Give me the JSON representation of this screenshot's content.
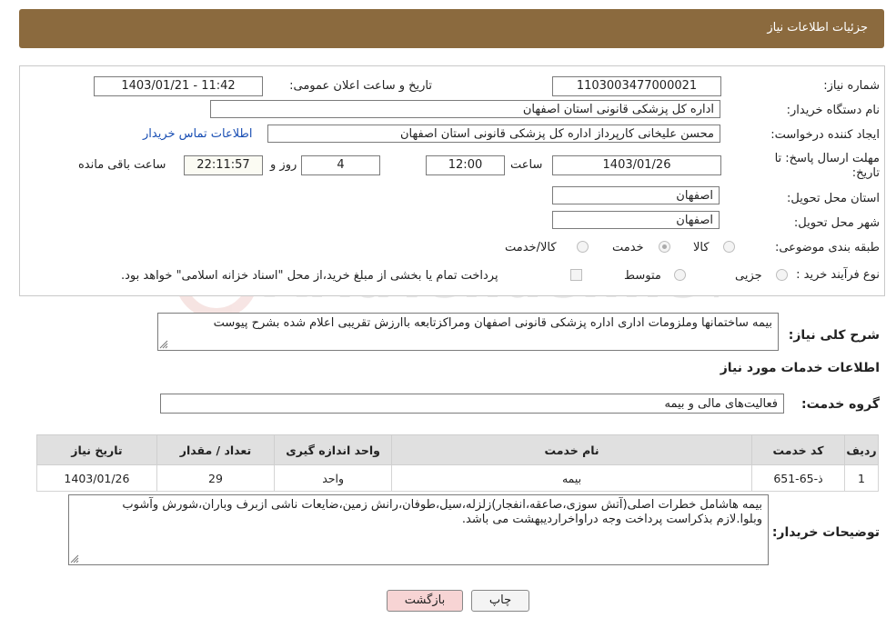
{
  "header": {
    "title": "جزئیات اطلاعات نیاز"
  },
  "form": {
    "need_number_label": "شماره نیاز:",
    "need_number": "1103003477000021",
    "announce_label": "تاریخ و ساعت اعلان عمومی:",
    "announce_value": "1403/01/21 - 11:42",
    "buyer_org_label": "نام دستگاه خریدار:",
    "buyer_org": "اداره کل پزشکی قانونی استان اصفهان",
    "creator_label": "ایجاد کننده درخواست:",
    "creator": "محسن علیخانی کارپرداز اداره کل پزشکی قانونی استان اصفهان",
    "contact_link": "اطلاعات تماس خریدار",
    "deadline_label_1": "مهلت ارسال پاسخ: تا",
    "deadline_label_2": "تاریخ:",
    "deadline_date": "1403/01/26",
    "time_label": "ساعت",
    "deadline_time": "12:00",
    "days_value": "4",
    "days_label": "روز و",
    "remaining_time": "22:11:57",
    "remaining_label": "ساعت باقی مانده",
    "province_label": "استان محل تحویل:",
    "province": "اصفهان",
    "city_label": "شهر محل تحویل:",
    "city": "اصفهان",
    "category_label": "طبقه بندی موضوعی:",
    "category_options": [
      "کالا",
      "خدمت",
      "کالا/خدمت"
    ],
    "category_selected": "خدمت",
    "process_label": "نوع فرآیند خرید :",
    "process_options": [
      "جزیی",
      "متوسط"
    ],
    "payment_note": "پرداخت تمام یا بخشی از مبلغ خرید،از محل \"اسناد خزانه اسلامی\" خواهد بود."
  },
  "summary": {
    "label": "شرح کلی نیاز:",
    "text": "بیمه ساختمانها وملزومات اداری اداره پزشکی قانونی اصفهان ومراکزتابعه باارزش تقریبی اعلام شده بشرح پیوست"
  },
  "services": {
    "section_title": "اطلاعات خدمات مورد نیاز",
    "group_label": "گروه خدمت:",
    "group_value": "فعالیت‌های مالی و بیمه",
    "columns": [
      "ردیف",
      "کد خدمت",
      "نام خدمت",
      "واحد اندازه گیری",
      "تعداد / مقدار",
      "تاریخ نیاز"
    ],
    "rows": [
      {
        "index": "1",
        "code": "ذ-65-651",
        "name": "بیمه",
        "unit": "واحد",
        "qty": "29",
        "date": "1403/01/26"
      }
    ]
  },
  "buyer_notes": {
    "label": "توضیحات خریدار:",
    "text": "بیمه هاشامل خطرات اصلی(آتش سوزی،صاعقه،انفجار)زلزله،سیل،طوفان،رانش زمین،ضایعات ناشی ازبرف وباران،شورش وآشوب وبلوا.لازم بذکراست پرداخت وجه دراواخراردیبهشت می باشد."
  },
  "buttons": {
    "print": "چاپ",
    "back": "بازگشت"
  },
  "watermark": {
    "text": "AriaTender.neT"
  },
  "colors": {
    "header_bg": "#8b6a3e",
    "link": "#1a4fb4",
    "back_btn_bg": "#f7d4d4"
  }
}
